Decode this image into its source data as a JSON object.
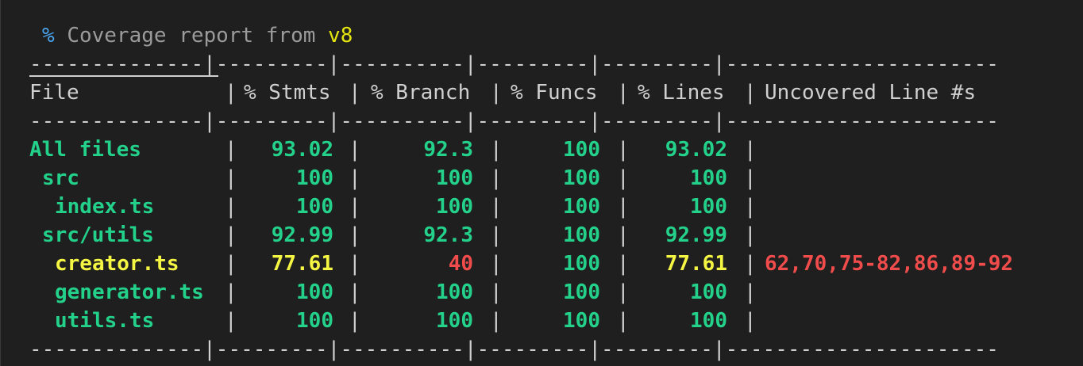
{
  "title": {
    "percent_symbol": "%",
    "text": "Coverage report from",
    "provider": "v8"
  },
  "separator": "--------------|---------|----------|---------|---------|----------------------",
  "headers": {
    "file": "File",
    "stmts": "% Stmts",
    "branch": "% Branch",
    "funcs": "% Funcs",
    "lines": "% Lines",
    "uncovered": "Uncovered Line #s"
  },
  "rows": [
    {
      "file": "All files",
      "indent": 0,
      "stmts": "93.02",
      "branch": "92.3",
      "funcs": "100",
      "lines": "93.02",
      "uncovered": "",
      "color_file": "green",
      "color_stmts": "green",
      "color_branch": "green",
      "color_funcs": "green",
      "color_lines": "green"
    },
    {
      "file": "src",
      "indent": 1,
      "stmts": "100",
      "branch": "100",
      "funcs": "100",
      "lines": "100",
      "uncovered": "",
      "color_file": "green",
      "color_stmts": "green",
      "color_branch": "green",
      "color_funcs": "green",
      "color_lines": "green"
    },
    {
      "file": "index.ts",
      "indent": 2,
      "stmts": "100",
      "branch": "100",
      "funcs": "100",
      "lines": "100",
      "uncovered": "",
      "color_file": "green",
      "color_stmts": "green",
      "color_branch": "green",
      "color_funcs": "green",
      "color_lines": "green"
    },
    {
      "file": "src/utils",
      "indent": 1,
      "stmts": "92.99",
      "branch": "92.3",
      "funcs": "100",
      "lines": "92.99",
      "uncovered": "",
      "color_file": "green",
      "color_stmts": "green",
      "color_branch": "green",
      "color_funcs": "green",
      "color_lines": "green"
    },
    {
      "file": "creator.ts",
      "indent": 2,
      "stmts": "77.61",
      "branch": "40",
      "funcs": "100",
      "lines": "77.61",
      "uncovered": "62,70,75-82,86,89-92",
      "color_file": "yellow",
      "color_stmts": "yellow",
      "color_branch": "red",
      "color_funcs": "green",
      "color_lines": "yellow"
    },
    {
      "file": "generator.ts",
      "indent": 2,
      "stmts": "100",
      "branch": "100",
      "funcs": "100",
      "lines": "100",
      "uncovered": "",
      "color_file": "green",
      "color_stmts": "green",
      "color_branch": "green",
      "color_funcs": "green",
      "color_lines": "green"
    },
    {
      "file": "utils.ts",
      "indent": 2,
      "stmts": "100",
      "branch": "100",
      "funcs": "100",
      "lines": "100",
      "uncovered": "",
      "color_file": "green",
      "color_stmts": "green",
      "color_branch": "green",
      "color_funcs": "green",
      "color_lines": "green"
    }
  ],
  "colors": {
    "green": "#23d18b",
    "yellow": "#f5f543",
    "red": "#f14c4c",
    "blue": "#4aa5f0",
    "background": "#1f1f1f"
  }
}
